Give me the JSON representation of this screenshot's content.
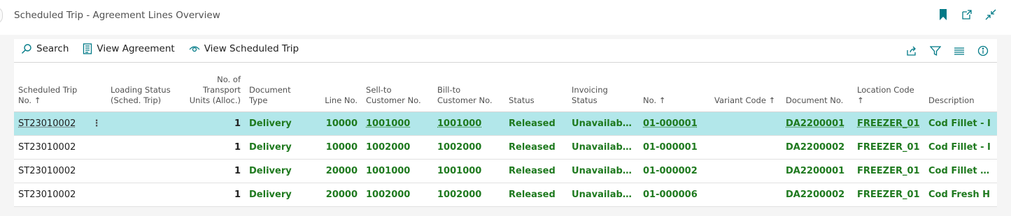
{
  "page": {
    "title": "Scheduled Trip - Agreement Lines Overview"
  },
  "toolbar": {
    "actions": [
      {
        "label": "Search",
        "icon": "search-icon"
      },
      {
        "label": "View Agreement",
        "icon": "document-icon"
      },
      {
        "label": "View Scheduled Trip",
        "icon": "eye-icon"
      }
    ],
    "right_icons": [
      "share-icon",
      "filter-icon",
      "list-icon",
      "info-icon"
    ]
  },
  "top_icons": [
    "bookmark-icon",
    "open-new-window-icon",
    "collapse-icon"
  ],
  "colors": {
    "accent": "#007a87",
    "selected_row": "#b2e7ea",
    "field_green": "#1f7a1f"
  },
  "table": {
    "headers": {
      "trip_no": [
        "Scheduled Trip",
        "No. ↑"
      ],
      "loading_status": [
        "Loading Status",
        "(Sched. Trip)"
      ],
      "transport_units": [
        "No. of",
        "Transport",
        "Units (Alloc.)"
      ],
      "doc_type": [
        "Document",
        "Type"
      ],
      "line_no": [
        "Line No."
      ],
      "sell_to": [
        "Sell-to",
        "Customer No."
      ],
      "bill_to": [
        "Bill-to",
        "Customer No."
      ],
      "status": [
        "Status"
      ],
      "invoicing_status": [
        "Invoicing",
        "Status"
      ],
      "no": [
        "No. ↑"
      ],
      "variant_code": [
        "Variant Code ↑"
      ],
      "document_no": [
        "Document No."
      ],
      "location_code": [
        "Location Code",
        "↑"
      ],
      "description": [
        "Description"
      ]
    },
    "rows": [
      {
        "trip_no": "ST23010002",
        "menu": "⋮",
        "loading_status": "",
        "transport_units": "1",
        "doc_type": "Delivery",
        "line_no": "10000",
        "sell_to": "1001000",
        "bill_to": "1001000",
        "status": "Released",
        "invoicing_status": "Unavailable ...",
        "no": "01-000001",
        "variant_code": "",
        "document_no": "DA2200001",
        "location_code": "FREEZER_01",
        "description": "Cod Fillet - I"
      },
      {
        "trip_no": "ST23010002",
        "menu": "",
        "loading_status": "",
        "transport_units": "1",
        "doc_type": "Delivery",
        "line_no": "10000",
        "sell_to": "1002000",
        "bill_to": "1002000",
        "status": "Released",
        "invoicing_status": "Unavailable ...",
        "no": "01-000001",
        "variant_code": "",
        "document_no": "DA2200002",
        "location_code": "FREEZER_01",
        "description": "Cod Fillet - I"
      },
      {
        "trip_no": "ST23010002",
        "menu": "",
        "loading_status": "",
        "transport_units": "1",
        "doc_type": "Delivery",
        "line_no": "20000",
        "sell_to": "1001000",
        "bill_to": "1001000",
        "status": "Released",
        "invoicing_status": "Unavailable ...",
        "no": "01-000002",
        "variant_code": "",
        "document_no": "DA2200001",
        "location_code": "FREEZER_01",
        "description": "Cod Fillet - S"
      },
      {
        "trip_no": "ST23010002",
        "menu": "",
        "loading_status": "",
        "transport_units": "1",
        "doc_type": "Delivery",
        "line_no": "20000",
        "sell_to": "1002000",
        "bill_to": "1002000",
        "status": "Released",
        "invoicing_status": "Unavailable ...",
        "no": "01-000006",
        "variant_code": "",
        "document_no": "DA2200002",
        "location_code": "FREEZER_01",
        "description": "Cod Fresh H"
      }
    ]
  }
}
